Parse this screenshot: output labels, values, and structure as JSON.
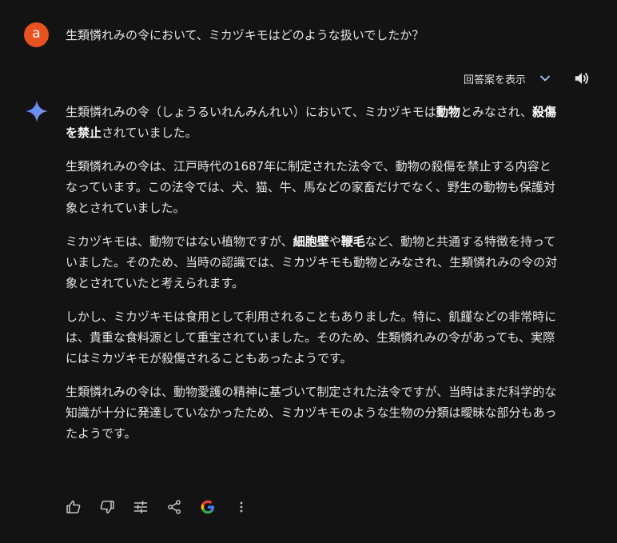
{
  "user": {
    "avatar_letter": "a",
    "avatar_color": "#e8521f",
    "message": "生類憐れみの令において、ミカヅキモはどのような扱いでしたか？"
  },
  "drafts": {
    "label": "回答案を表示",
    "chevron_icon": "chevron-down-icon",
    "speaker_icon": "volume-icon"
  },
  "response": {
    "icon": "gemini-sparkle-icon",
    "p1": {
      "t1": "生類憐れみの令（しょうるいれんみんれい）において、ミカヅキモは",
      "b1": "動物",
      "t2": "とみなされ、",
      "b2": "殺傷を禁止",
      "t3": "されていました。"
    },
    "p2": "生類憐れみの令は、江戸時代の1687年に制定された法令で、動物の殺傷を禁止する内容となっています。この法令では、犬、猫、牛、馬などの家畜だけでなく、野生の動物も保護対象とされていました。",
    "p3": {
      "t1": "ミカヅキモは、動物ではない植物ですが、",
      "b1": "細胞壁",
      "t2": "や",
      "b2": "鞭毛",
      "t3": "など、動物と共通する特徴を持っていました。そのため、当時の認識では、ミカヅキモも動物とみなされ、生類憐れみの令の対象とされていたと考えられます。"
    },
    "p4": "しかし、ミカヅキモは食用として利用されることもありました。特に、飢饉などの非常時には、貴重な食料源として重宝されていました。そのため、生類憐れみの令があっても、実際にはミカヅキモが殺傷されることもあったようです。",
    "p5": "生類憐れみの令は、動物愛護の精神に基づいて制定された法令ですが、当時はまだ科学的な知識が十分に発達していなかったため、ミカヅキモのような生物の分類は曖昧な部分もあったようです。"
  },
  "actions": {
    "items": [
      "thumb-up-icon",
      "thumb-down-icon",
      "tune-icon",
      "share-icon",
      "google-icon",
      "more-vert-icon"
    ]
  }
}
